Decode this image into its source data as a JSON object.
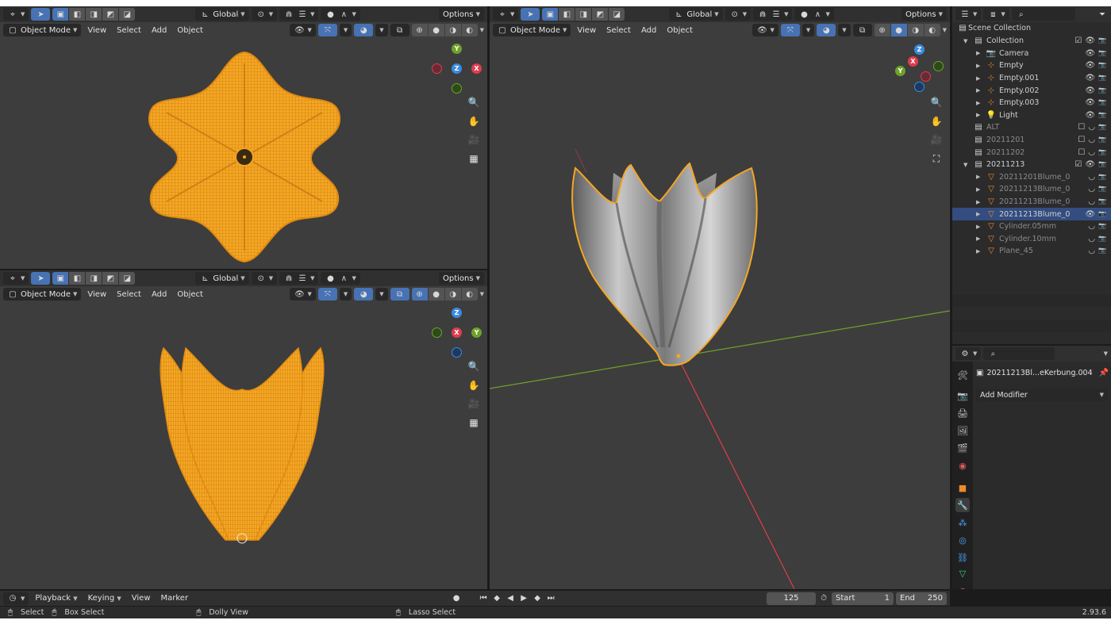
{
  "colors": {
    "accent": "#4772b3",
    "selection_orange": "#f5a623",
    "x_axis": "#e03c4f",
    "y_axis": "#6da22a",
    "z_axis": "#3a8be0"
  },
  "viewport": {
    "transform_orientation": "Global",
    "options_label": "Options",
    "mode_label": "Object Mode",
    "menus": [
      "View",
      "Select",
      "Add",
      "Object"
    ],
    "gizmo_top": {
      "top": "Y",
      "center": "Z",
      "right": "X"
    },
    "gizmo_front": {
      "top": "Z",
      "center": "X",
      "right": "Y"
    },
    "gizmo_persp": {
      "top": "Z",
      "left": "X",
      "bottom_left": "Y"
    }
  },
  "outliner": {
    "search_placeholder": "",
    "scene_collection": "Scene Collection",
    "rows": [
      {
        "label": "Collection",
        "indent": 1,
        "icon": "collection-icon",
        "expanded": true
      },
      {
        "label": "Camera",
        "indent": 2,
        "icon": "camera-icon"
      },
      {
        "label": "Empty",
        "indent": 2,
        "icon": "empty-icon"
      },
      {
        "label": "Empty.001",
        "indent": 2,
        "icon": "empty-icon"
      },
      {
        "label": "Empty.002",
        "indent": 2,
        "icon": "empty-icon"
      },
      {
        "label": "Empty.003",
        "indent": 2,
        "icon": "empty-icon"
      },
      {
        "label": "Light",
        "indent": 2,
        "icon": "light-icon"
      },
      {
        "label": "ALT",
        "indent": 1,
        "icon": "collection-icon",
        "dim": true
      },
      {
        "label": "20211201",
        "indent": 1,
        "icon": "collection-icon",
        "dim": true
      },
      {
        "label": "20211202",
        "indent": 1,
        "icon": "collection-icon",
        "dim": true
      },
      {
        "label": "20211213",
        "indent": 1,
        "icon": "collection-icon",
        "expanded": true
      },
      {
        "label": "20211201Blume_0",
        "indent": 2,
        "icon": "mesh-icon",
        "dim": true
      },
      {
        "label": "20211213Blume_0",
        "indent": 2,
        "icon": "mesh-icon",
        "dim": true
      },
      {
        "label": "20211213Blume_0",
        "indent": 2,
        "icon": "mesh-icon",
        "dim": true
      },
      {
        "label": "20211213Blume_0",
        "indent": 2,
        "icon": "mesh-icon",
        "selected": true
      },
      {
        "label": "Cylinder.05mm",
        "indent": 2,
        "icon": "mesh-icon",
        "dim": true
      },
      {
        "label": "Cylinder.10mm",
        "indent": 2,
        "icon": "mesh-icon",
        "dim": true
      },
      {
        "label": "Plane_45",
        "indent": 2,
        "icon": "mesh-icon",
        "dim": true
      }
    ]
  },
  "properties": {
    "object_name": "20211213Bl...eKerbung.004",
    "add_modifier_label": "Add Modifier"
  },
  "timeline": {
    "menus": [
      "Playback",
      "Keying",
      "View",
      "Marker"
    ],
    "current_frame": "125",
    "start_label": "Start",
    "start_value": "1",
    "end_label": "End",
    "end_value": "250"
  },
  "statusbar": {
    "select": "Select",
    "box_select": "Box Select",
    "dolly_view": "Dolly View",
    "lasso_select": "Lasso Select",
    "version": "2.93.6"
  }
}
